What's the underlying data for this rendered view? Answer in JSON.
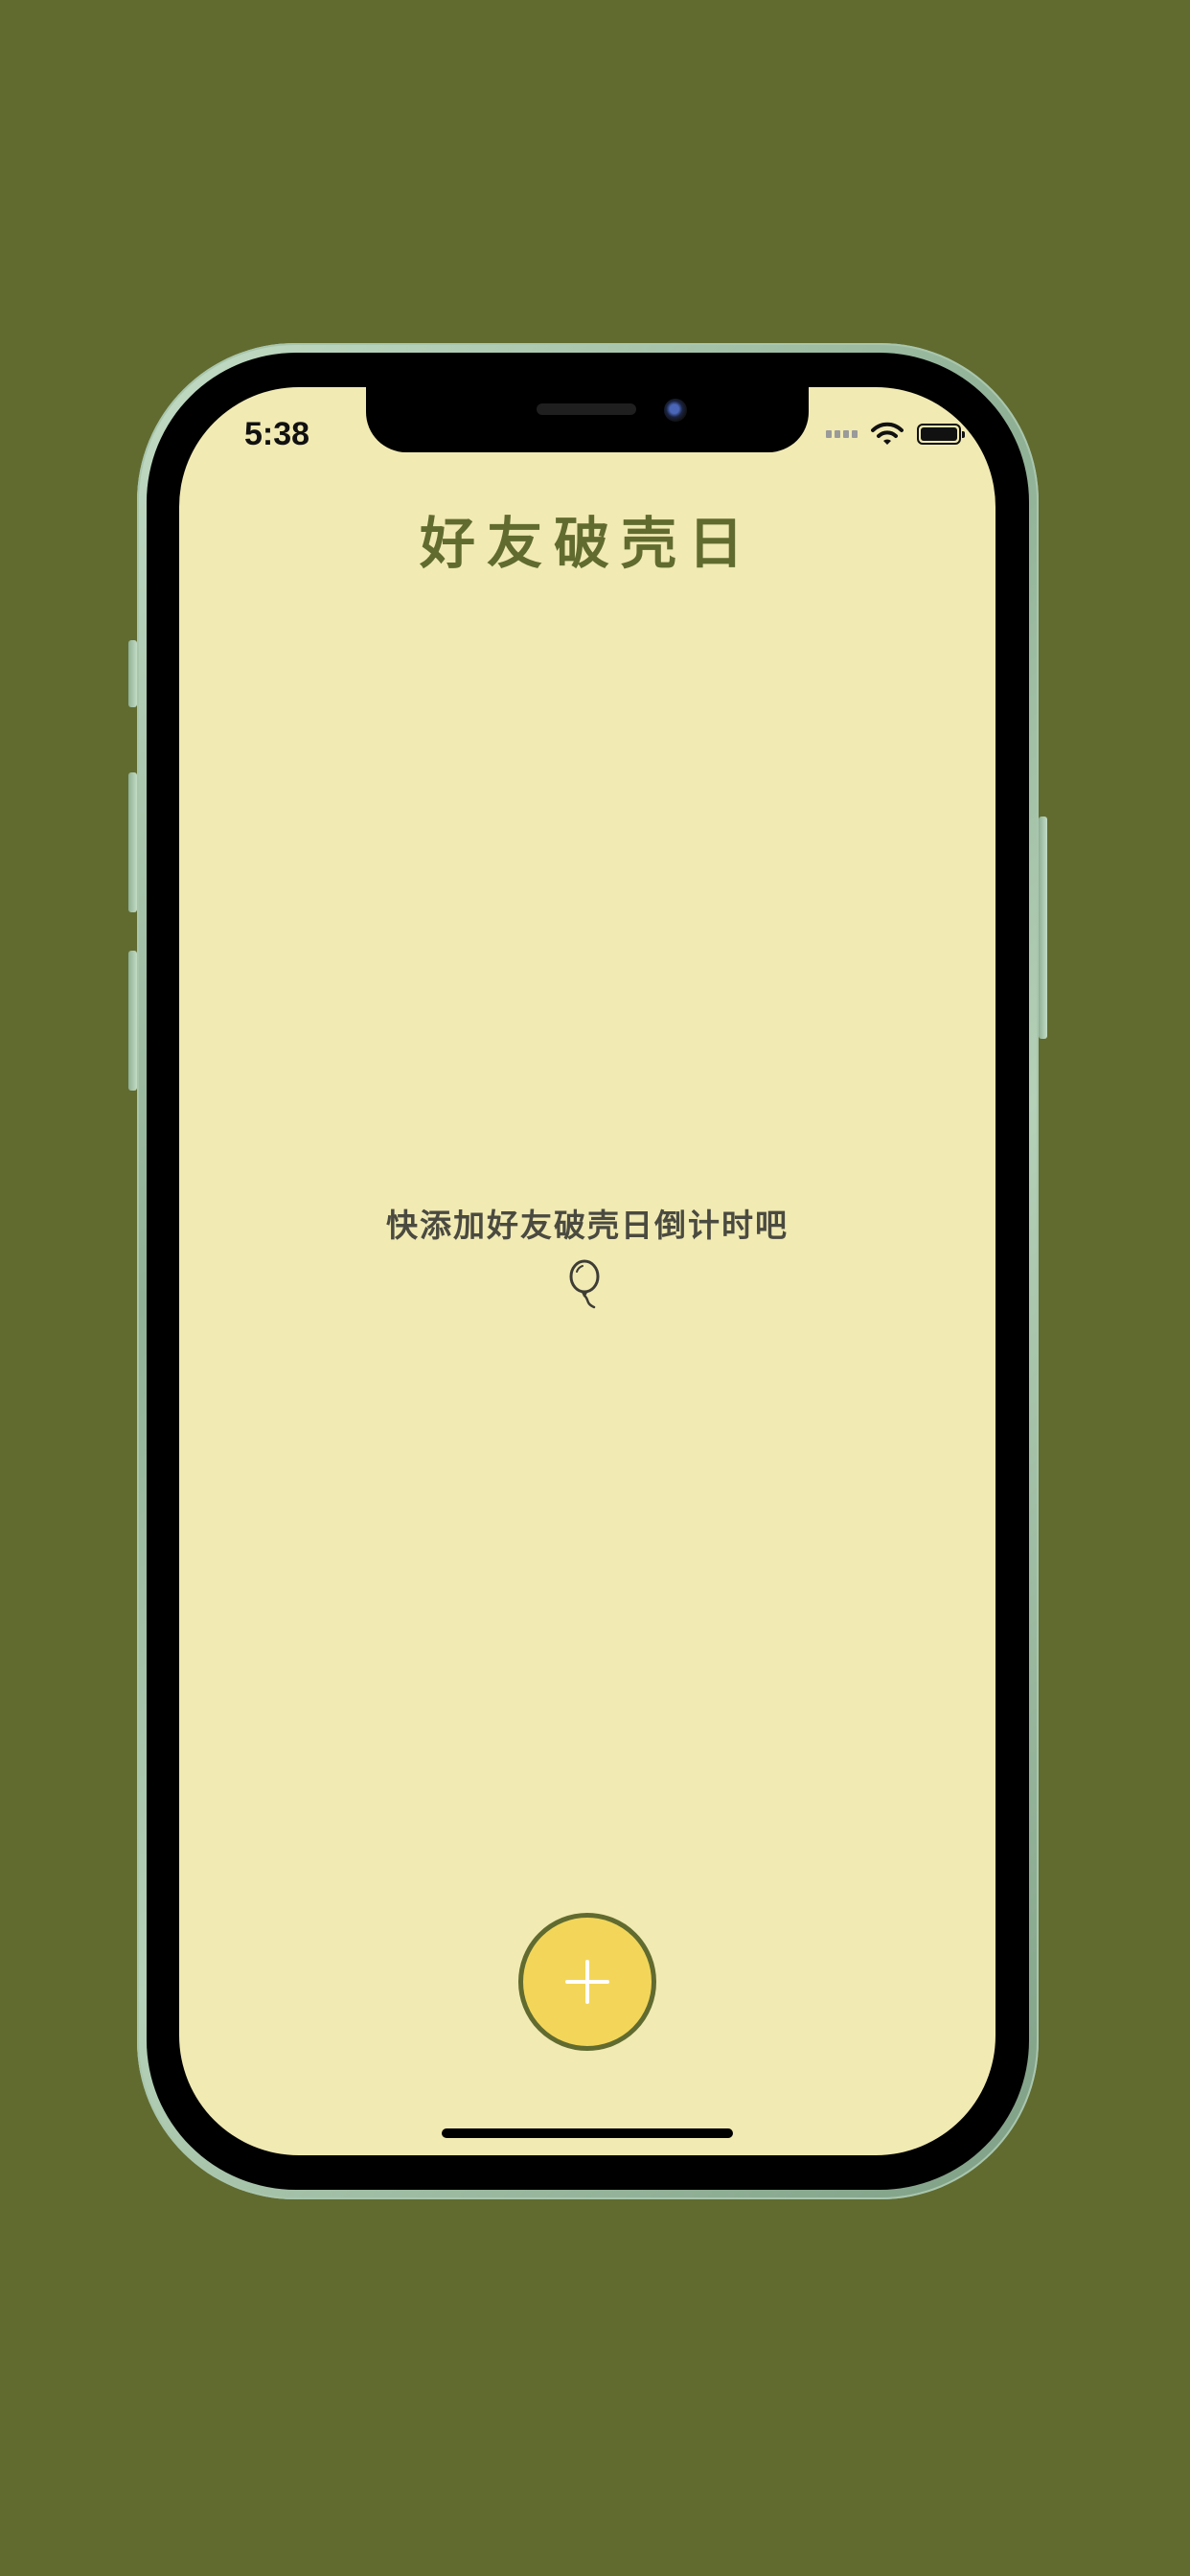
{
  "status_bar": {
    "time": "5:38"
  },
  "header": {
    "title": "好友破壳日"
  },
  "empty_state": {
    "message": "快添加好友破壳日倒计时吧",
    "icon": "balloon-icon"
  },
  "fab": {
    "icon": "plus-icon"
  },
  "colors": {
    "page_background": "#616b30",
    "screen_background": "#f1eab3",
    "title": "#616b30",
    "fab_fill": "#f3d659",
    "fab_border": "#616b30"
  }
}
